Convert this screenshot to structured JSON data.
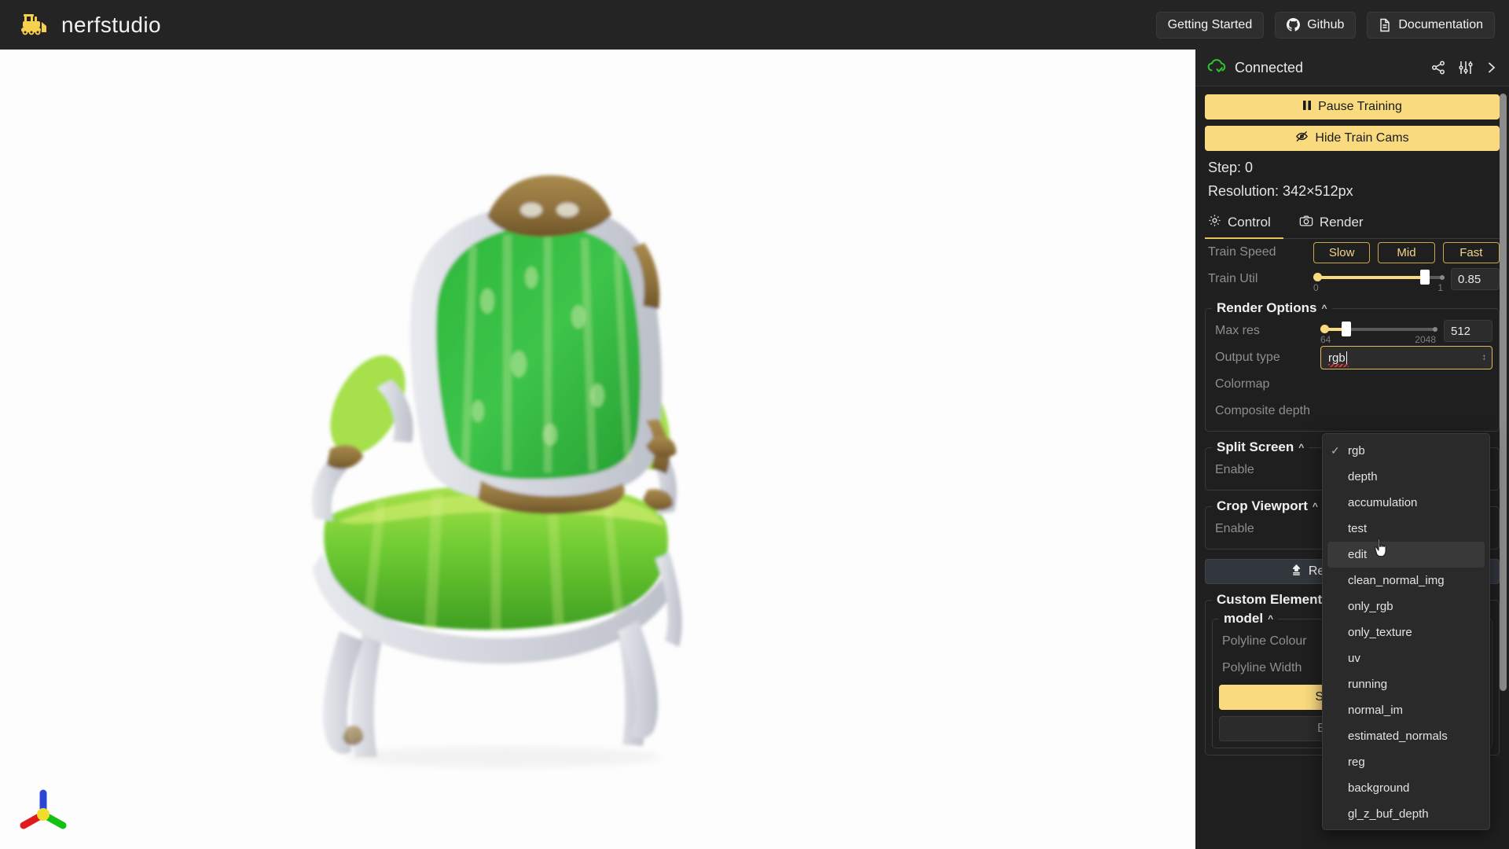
{
  "app": {
    "brand": "nerfstudio",
    "brand_icon": "bulldozer-logo-icon"
  },
  "topnav": {
    "getting_started": "Getting Started",
    "github": "Github",
    "documentation": "Documentation"
  },
  "panel": {
    "status": "Connected",
    "status_icon": "cloud-check-icon",
    "status_color": "#2ec92e",
    "header_icons": [
      "share-icon",
      "sliders-icon",
      "chevron-right-icon"
    ],
    "pause_training": "Pause Training",
    "pause_icon": "pause-icon",
    "hide_train_cams": "Hide Train Cams",
    "hide_icon": "eye-off-icon",
    "step": "Step: 0",
    "resolution": "Resolution: 342×512px",
    "tabs": [
      {
        "label": "Control",
        "icon": "gear-icon",
        "active": true
      },
      {
        "label": "Render",
        "icon": "camera-icon",
        "active": false
      }
    ],
    "train_speed": {
      "label": "Train Speed",
      "options": [
        "Slow",
        "Mid",
        "Fast"
      ]
    },
    "train_util": {
      "label": "Train Util",
      "min": "0",
      "max": "1",
      "value": "0.85",
      "fill_percent": 85
    },
    "render_options": {
      "title": "Render Options",
      "max_res": {
        "label": "Max res",
        "min": "64",
        "max": "2048",
        "value": "512",
        "fill_percent": 22
      },
      "output_type": {
        "label": "Output type",
        "value": "rgb"
      },
      "colormap_label": "Colormap",
      "composite_depth_label": "Composite depth"
    },
    "split_screen": {
      "title": "Split Screen",
      "enable_label": "Enable"
    },
    "crop_viewport": {
      "title": "Crop Viewport",
      "enable_label": "Enable"
    },
    "reset_up_direction": "Reset Up Direction",
    "reset_icon": "arrow-up-icon",
    "custom_elements": {
      "title": "Custom Elements",
      "model_title": "model",
      "polyline_colour_label": "Polyline Colour",
      "polyline_width_label": "Polyline Width",
      "start_button": "Start Polyline",
      "end_button": "End Polyline"
    }
  },
  "dropdown": {
    "selected": "rgb",
    "hovered": "edit",
    "options": [
      "rgb",
      "depth",
      "accumulation",
      "test",
      "edit",
      "clean_normal_img",
      "only_rgb",
      "only_texture",
      "uv",
      "running",
      "normal_im",
      "estimated_normals",
      "reg",
      "background",
      "gl_z_buf_depth"
    ]
  },
  "viewport": {
    "scene_description": "NeRF rendering of an antique green upholstered armchair",
    "gizmo": {
      "name": "axis-gizmo",
      "x_color": "#e01b1b",
      "y_color": "#12c112",
      "z_color": "#2a46d8",
      "center_color": "#f2dd2c"
    }
  }
}
